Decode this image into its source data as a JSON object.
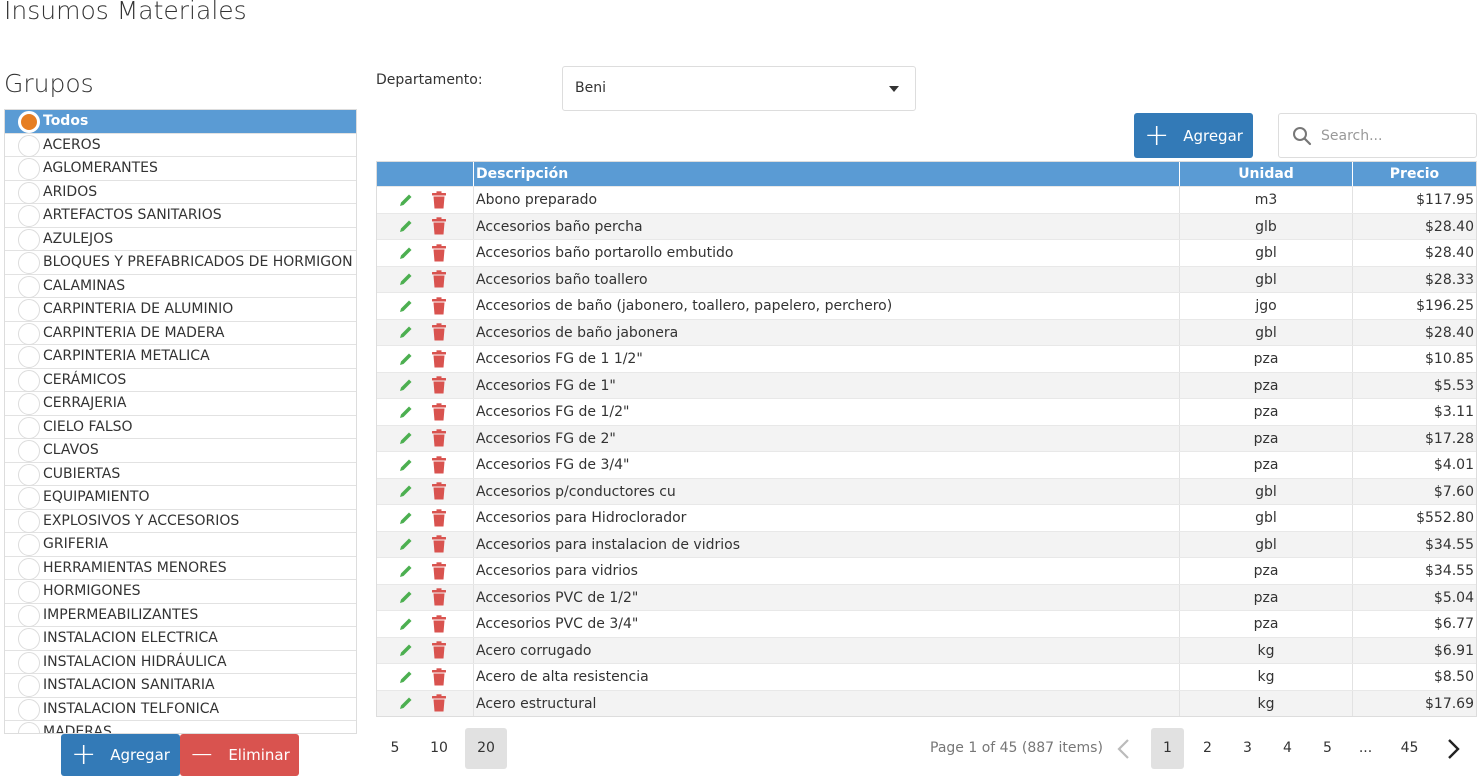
{
  "page_title": "Insumos Materiales",
  "groups": {
    "title": "Grupos",
    "items": [
      {
        "label": "Todos",
        "selected": true
      },
      {
        "label": "ACEROS"
      },
      {
        "label": "AGLOMERANTES"
      },
      {
        "label": "ARIDOS"
      },
      {
        "label": "ARTEFACTOS SANITARIOS"
      },
      {
        "label": "AZULEJOS"
      },
      {
        "label": "BLOQUES Y PREFABRICADOS DE HORMIGON"
      },
      {
        "label": "CALAMINAS"
      },
      {
        "label": "CARPINTERIA DE ALUMINIO"
      },
      {
        "label": "CARPINTERIA DE MADERA"
      },
      {
        "label": "CARPINTERIA METALICA"
      },
      {
        "label": "CERÁMICOS"
      },
      {
        "label": "CERRAJERIA"
      },
      {
        "label": "CIELO FALSO"
      },
      {
        "label": "CLAVOS"
      },
      {
        "label": "CUBIERTAS"
      },
      {
        "label": "EQUIPAMIENTO"
      },
      {
        "label": "EXPLOSIVOS Y ACCESORIOS"
      },
      {
        "label": "GRIFERIA"
      },
      {
        "label": "HERRAMIENTAS MENORES"
      },
      {
        "label": "HORMIGONES"
      },
      {
        "label": "IMPERMEABILIZANTES"
      },
      {
        "label": "INSTALACION ELECTRICA"
      },
      {
        "label": "INSTALACION HIDRÁULICA"
      },
      {
        "label": "INSTALACION SANITARIA"
      },
      {
        "label": "INSTALACION TELFONICA"
      },
      {
        "label": "MADERAS"
      }
    ],
    "add_label": "Agregar",
    "delete_label": "Eliminar"
  },
  "department": {
    "label": "Departamento:",
    "value": "Beni"
  },
  "toolbar": {
    "add_label": "Agregar",
    "search_placeholder": "Search..."
  },
  "grid": {
    "headers": {
      "description": "Descripción",
      "unit": "Unidad",
      "price": "Precio"
    },
    "rows": [
      {
        "description": "Abono preparado",
        "unit": "m3",
        "price": "$117.95"
      },
      {
        "description": "Accesorios baño percha",
        "unit": "glb",
        "price": "$28.40"
      },
      {
        "description": "Accesorios baño portarollo embutido",
        "unit": "gbl",
        "price": "$28.40"
      },
      {
        "description": "Accesorios baño toallero",
        "unit": "gbl",
        "price": "$28.33"
      },
      {
        "description": "Accesorios de baño (jabonero, toallero, papelero, perchero)",
        "unit": "jgo",
        "price": "$196.25"
      },
      {
        "description": "Accesorios de baño jabonera",
        "unit": "gbl",
        "price": "$28.40"
      },
      {
        "description": "Accesorios FG de 1 1/2\"",
        "unit": "pza",
        "price": "$10.85"
      },
      {
        "description": "Accesorios FG de 1\"",
        "unit": "pza",
        "price": "$5.53"
      },
      {
        "description": "Accesorios FG de 1/2\"",
        "unit": "pza",
        "price": "$3.11"
      },
      {
        "description": "Accesorios FG de 2\"",
        "unit": "pza",
        "price": "$17.28"
      },
      {
        "description": "Accesorios FG de 3/4\"",
        "unit": "pza",
        "price": "$4.01"
      },
      {
        "description": "Accesorios p/conductores cu",
        "unit": "gbl",
        "price": "$7.60"
      },
      {
        "description": "Accesorios para Hidroclorador",
        "unit": "gbl",
        "price": "$552.80"
      },
      {
        "description": "Accesorios para instalacion de vidrios",
        "unit": "gbl",
        "price": "$34.55"
      },
      {
        "description": "Accesorios para vidrios",
        "unit": "pza",
        "price": "$34.55"
      },
      {
        "description": "Accesorios PVC de 1/2\"",
        "unit": "pza",
        "price": "$5.04"
      },
      {
        "description": "Accesorios PVC de 3/4\"",
        "unit": "pza",
        "price": "$6.77"
      },
      {
        "description": "Acero corrugado",
        "unit": "kg",
        "price": "$6.91"
      },
      {
        "description": "Acero de alta resistencia",
        "unit": "kg",
        "price": "$8.50"
      },
      {
        "description": "Acero estructural",
        "unit": "kg",
        "price": "$17.69"
      }
    ]
  },
  "pager": {
    "sizes": [
      "5",
      "10",
      "20"
    ],
    "active_size": "20",
    "info": "Page 1 of 45 (887 items)",
    "pages": [
      "1",
      "2",
      "3",
      "4",
      "5",
      "...",
      "45"
    ],
    "active_page": "1"
  },
  "colors": {
    "header_blue": "#5a9bd4",
    "primary_button": "#337ab7",
    "danger_button": "#d9534f",
    "edit_icon": "#4caf50",
    "delete_icon": "#d9534f",
    "radio_selected": "#e67e22"
  },
  "icons": {
    "row_edit": "pencil-icon",
    "row_delete": "trash-icon",
    "add": "plus-icon",
    "remove": "minus-icon",
    "search": "search-icon",
    "dropdown": "caret-down-icon",
    "prev": "chevron-left-icon",
    "next": "chevron-right-icon"
  }
}
